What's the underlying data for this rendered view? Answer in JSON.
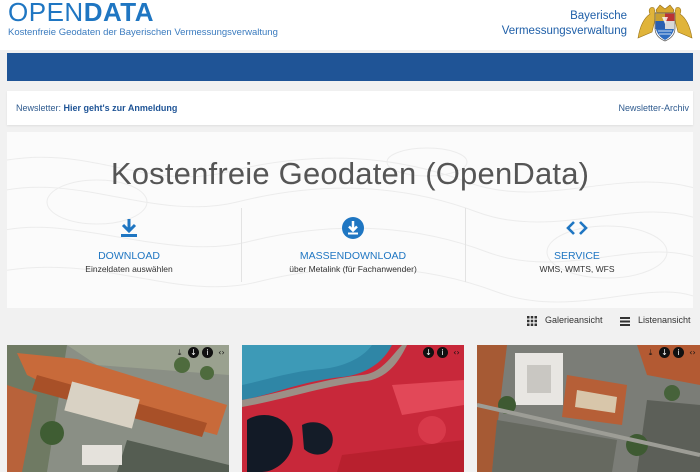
{
  "header": {
    "logo_open": "OPEN",
    "logo_data": "DATA",
    "tagline": "Kostenfreie Geodaten der Bayerischen Vermessungsverwaltung",
    "org_line1": "Bayerische",
    "org_line2": "Vermessungsverwaltung"
  },
  "newsletter": {
    "prefix": "Newsletter: ",
    "link": "Hier geht's zur Anmeldung",
    "archive": "Newsletter-Archiv"
  },
  "hero": {
    "title": "Kostenfreie Geodaten (OpenData)",
    "features": [
      {
        "title": "DOWNLOAD",
        "subtitle": "Einzeldaten auswählen",
        "icon": "download-icon"
      },
      {
        "title": "MASSENDOWNLOAD",
        "subtitle": "über Metalink (für Fachanwender)",
        "icon": "download-circle-icon"
      },
      {
        "title": "SERVICE",
        "subtitle": "WMS, WMTS, WFS",
        "icon": "code-icon"
      }
    ]
  },
  "view": {
    "gallery": "Galerieansicht",
    "list": "Listenansicht"
  },
  "colors": {
    "brand_blue": "#1f76c2",
    "bar_blue": "#1f5496"
  }
}
